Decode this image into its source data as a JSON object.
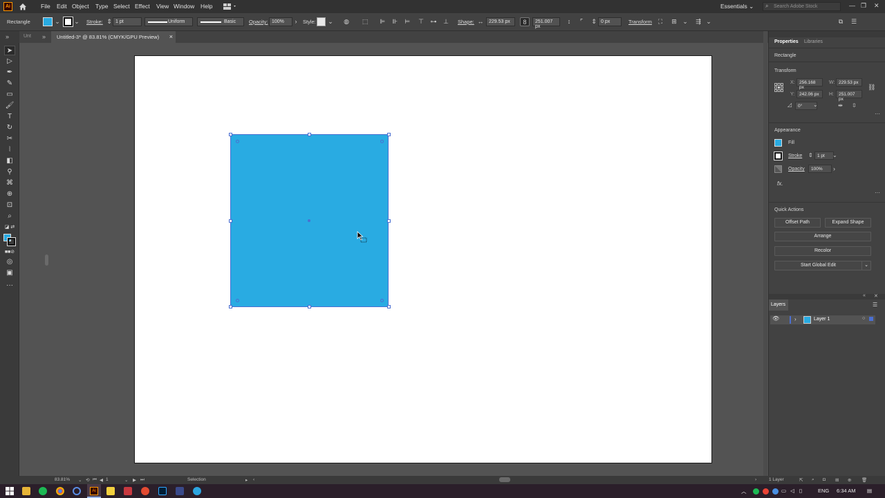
{
  "menubar": {
    "app_icon": "Ai",
    "items": [
      "File",
      "Edit",
      "Object",
      "Type",
      "Select",
      "Effect",
      "View",
      "Window",
      "Help"
    ],
    "workspace": "Essentials",
    "search_placeholder": "Search Adobe Stock"
  },
  "controlbar": {
    "object_type": "Rectangle",
    "stroke_label": "Stroke:",
    "stroke_weight": "1 pt",
    "profile": "Uniform",
    "brush": "Basic",
    "opacity_label": "Opacity:",
    "opacity_value": "100%",
    "style_label": "Style:",
    "shape_label": "Shape:",
    "width_value": "229.53 px",
    "height_value": "251.007 px",
    "corner_value": "0 px",
    "transform_label": "Transform",
    "fill_color": "#29abe2"
  },
  "document": {
    "unit_label": "Unt",
    "tab_title": "Untitled-3* @ 83.81% (CMYK/GPU Preview)",
    "close_symbol": "×"
  },
  "properties": {
    "tab_properties": "Properties",
    "tab_libraries": "Libraries",
    "object_type": "Rectangle",
    "transform_heading": "Transform",
    "x_label": "X:",
    "x_value": "256.168 px",
    "y_label": "Y:",
    "y_value": "242.06 px",
    "w_label": "W:",
    "w_value": "229.53 px",
    "h_label": "H:",
    "h_value": "251.007 px",
    "angle_value": "0°",
    "appearance_heading": "Appearance",
    "fill_label": "Fill",
    "stroke_label": "Stroke",
    "stroke_value": "1 pt",
    "opacity_label": "Opacity",
    "opacity_value": "100%",
    "fx_label": "fx.",
    "quick_actions_heading": "Quick Actions",
    "btn_offset_path": "Offset Path",
    "btn_expand_shape": "Expand Shape",
    "btn_arrange": "Arrange",
    "btn_recolor": "Recolor",
    "btn_global_edit": "Start Global Edit"
  },
  "layers": {
    "title": "Layers",
    "layer_name": "Layer 1",
    "count": "1 Layer"
  },
  "statusbar": {
    "zoom": "83.81%",
    "artboard_num": "1",
    "tool": "Selection"
  },
  "taskbar": {
    "lang": "ENG",
    "time": "6:34 AM"
  }
}
